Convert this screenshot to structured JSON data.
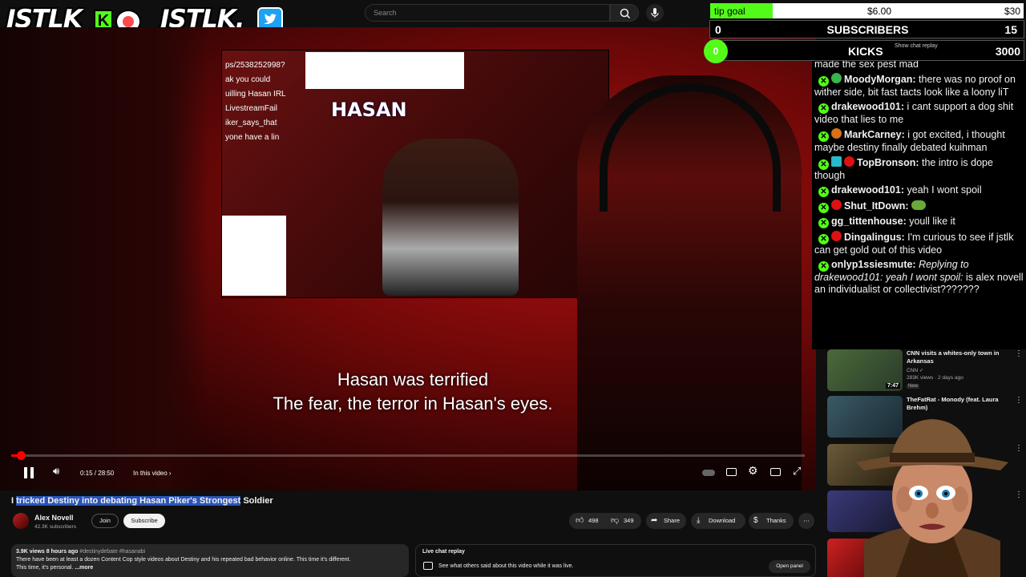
{
  "overlay": {
    "logo_left": "JSTLK",
    "logo_left_badge": "K",
    "logo_right": "JSTLK.",
    "tip_goal": {
      "label": "tip goal",
      "current": "$6.00",
      "target": "$30",
      "progress": 0.2
    },
    "subscribers": {
      "count_left": "0",
      "label": "SUBSCRIBERS",
      "count_right": "15"
    },
    "kicks": {
      "count": "0",
      "label": "KICKS",
      "hint": "Show chat replay",
      "target": "3000"
    }
  },
  "youtube": {
    "search_placeholder": "Search",
    "icons": {
      "search": "search-icon",
      "mic": "mic-icon"
    },
    "video": {
      "inner_logo": "HASAN",
      "inner_chat_lines": [
        "ps/2538252998?",
        "ak you could",
        "uilling Hasan IRL",
        "",
        "LivestreamFail",
        "iker_says_that",
        "yone have a lin"
      ],
      "subtitle_line1": "Hasan was terrified",
      "subtitle_line2": "The fear, the terror in Hasan's eyes.",
      "progress": 0.009,
      "time": "0:15 / 28:50",
      "chapter": "In this video ›"
    },
    "title_highlighted": "tricked Destiny into debating Hasan Piker's Strongest",
    "title_prefix": "I ",
    "title_suffix": " Soldier",
    "channel": {
      "name": "Alex Novell",
      "subs": "42.3K subscribers",
      "join": "Join",
      "subscribe": "Subscribe"
    },
    "actions": {
      "likes": "498",
      "dislikes": "349",
      "share": "Share",
      "download": "Download",
      "thanks": "Thanks",
      "more": "⋯"
    },
    "description": {
      "stats": "3.9K views  8 hours ago",
      "tags": "#destinydebate #hasanabi",
      "text1": "There have been at least a dozen Content Cop style videos about Destiny and his repeated bad behavior online. This time it's different.",
      "text2": "This time, it's personal.",
      "more": "...more"
    },
    "live_chat": {
      "title": "Live chat replay",
      "desc": "See what others said about this video while it was live.",
      "button": "Open panel"
    }
  },
  "chat": [
    {
      "user": "",
      "text": "made the sex pest mad",
      "partial": true,
      "dot": ""
    },
    {
      "user": "MoodyMorgan:",
      "text": " there was no proof on wither side, bit fast tacts look like a loony liT",
      "dot": "#3ab54a"
    },
    {
      "user": "drakewood101:",
      "text": " i cant support a dog shit video that lies to me",
      "dot": ""
    },
    {
      "user": "MarkCarney:",
      "text": " i got excited, i thought maybe destiny finally debated kuihman",
      "dot": "#d4731a"
    },
    {
      "user": "TopBronson:",
      "text": " the intro is dope though",
      "dot": "#d11"
    },
    {
      "user": "drakewood101:",
      "text": " yeah I wont spoil",
      "dot": ""
    },
    {
      "user": "Shut_ItDown:",
      "text": "",
      "dot": "#d11",
      "emote": true
    },
    {
      "user": "gg_tittenhouse:",
      "text": " youll like it",
      "dot": ""
    },
    {
      "user": "Dingalingus:",
      "text": " I'm curious to see if jstlk can get gold out of this video",
      "dot": "#d11"
    },
    {
      "user": "onlyp1ssiesmute:",
      "reply": " Replying to drakewood101: yeah I wont spoil:",
      "text": " is alex novell an individualist or collectivist???????",
      "dot": ""
    }
  ],
  "recommended": [
    {
      "title": "CNN visits a whites-only town in Arkansas",
      "channel": "CNN ✓",
      "meta": "283K views · 2 days ago",
      "new": "New",
      "duration": "7:47",
      "thumb": "#3d5a3a"
    },
    {
      "title": "TheFatRat - Monody (feat. Laura Brehm)",
      "channel": "",
      "meta": "",
      "new": "",
      "duration": "",
      "thumb": "#33505a"
    },
    {
      "title": "",
      "channel": "",
      "meta": "",
      "new": "",
      "duration": "",
      "thumb": "#55442a"
    },
    {
      "title": "",
      "channel": "",
      "meta": "",
      "new": "",
      "duration": "",
      "thumb": "#2a2a5a"
    }
  ],
  "colors": {
    "accent_red": "#ff0000",
    "kick_green": "#53fc18",
    "highlight_blue": "#2a55b7"
  }
}
